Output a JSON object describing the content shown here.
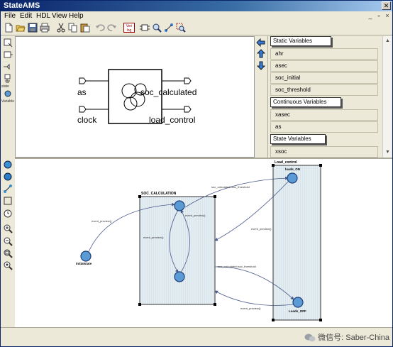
{
  "window": {
    "title": "StateAMS"
  },
  "menu": [
    "File",
    "Edit",
    "HDL",
    "View",
    "Help"
  ],
  "toolbar": {
    "icons": [
      "new-file-icon",
      "open-folder-icon",
      "save-icon",
      "print-icon",
      "cut-icon",
      "copy-icon",
      "paste-icon",
      "undo-icon",
      "redo-icon",
      "verilog-icon",
      "symbol-icon",
      "zoom-fit-icon",
      "connect-icon",
      "zoom-select-icon"
    ],
    "verilog_label_top": "Veri",
    "verilog_label_bot": "log"
  },
  "left_tools_top": {
    "label_1": "state",
    "label_2": "Variable"
  },
  "symbol": {
    "pins_left": [
      "as",
      "clock"
    ],
    "pins_right": [
      "soc_calculated",
      "load_control"
    ]
  },
  "variables": {
    "static_header": "Static Variables",
    "static_items": [
      "ahr",
      "asec",
      "soc_initial",
      "soc_threshold"
    ],
    "continuous_header": "Continuous Variables",
    "continuous_items": [
      "xasec",
      "as"
    ],
    "state_header": "State Variables",
    "state_items": [
      "xsoc"
    ]
  },
  "diagram": {
    "group_soc": "SOC_CALCULATION",
    "group_load": "Load_control",
    "states": {
      "initial": "initialstate",
      "load_on": "loads_ON",
      "load_off": "Loads_OFF"
    },
    "transitions": {
      "init_to_soc": "event_preview()",
      "soc_top_right": "event_preview()",
      "soc_left_loop": "event_preview()",
      "to_load_on": "soc_calculated>soc_threshold",
      "from_load_on": "event_preview()",
      "to_load_off": "soc_calculated<soc_threshold",
      "from_load_off": "event_preview()"
    }
  },
  "watermark": "微信号: Saber-China",
  "colors": {
    "state_fill": "#5b9bd5",
    "group_fill": "#d9e6ee",
    "titlebar": "#0a246a"
  }
}
